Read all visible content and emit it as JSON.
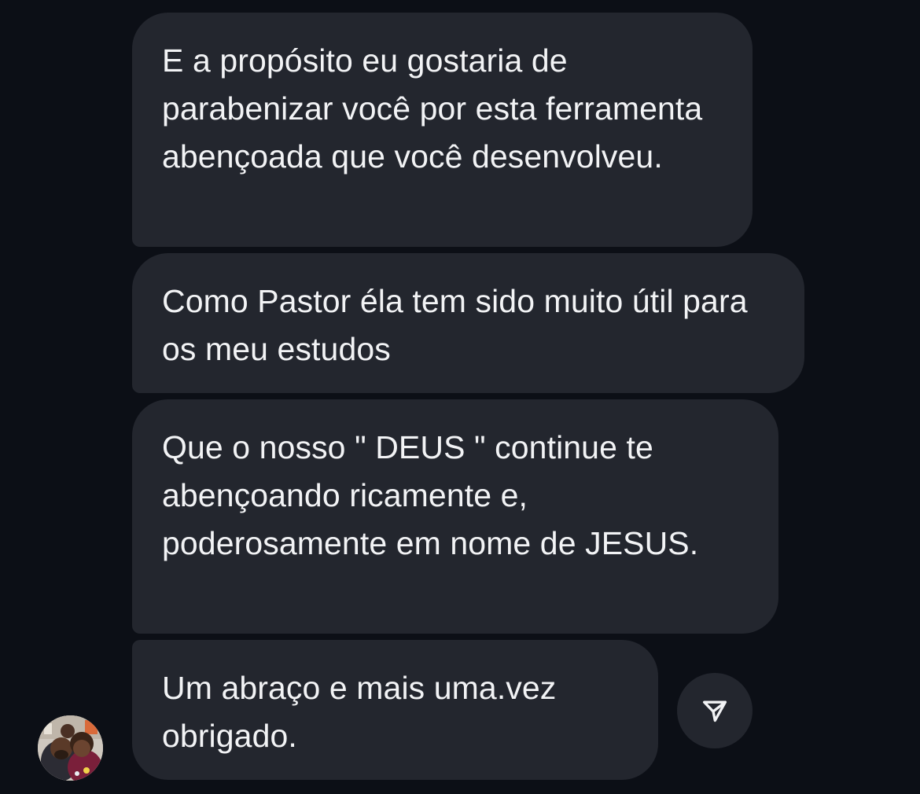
{
  "messages": [
    {
      "text": "E a propósito eu gostaria de parabenizar você por esta ferramenta abençoada que você desenvolveu."
    },
    {
      "text": "Como Pastor éla tem sido muito útil para os meu estudos"
    },
    {
      "text": "Que o nosso \" DEUS \" continue te abençoando ricamente e, poderosamente em nome de JESUS."
    },
    {
      "text": "Um abraço e mais uma.vez obrigado."
    }
  ],
  "icons": {
    "share": "paper-plane-icon",
    "avatar": "sender-avatar"
  },
  "colors": {
    "background": "#0c0f16",
    "bubble": "#23262e",
    "text": "#f2f3f5"
  }
}
